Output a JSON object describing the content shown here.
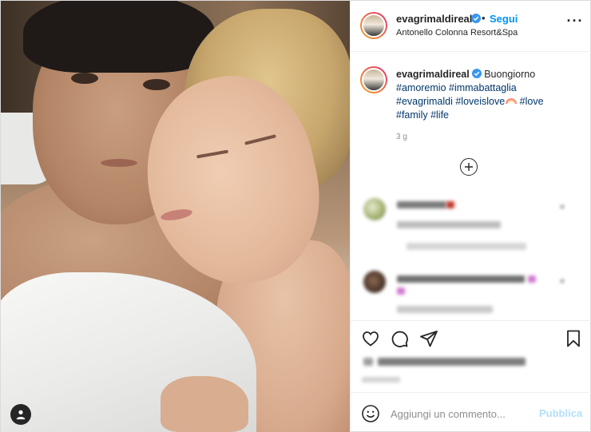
{
  "post": {
    "username": "evagrimaldireal",
    "follow_label": "Segui",
    "separator": "•",
    "location": "Antonello Colonna Resort&Spa",
    "more_label": "···"
  },
  "caption": {
    "username": "evagrimaldireal",
    "text": "Buongiorno",
    "tags_line1": "#amoremio #immabattaglia",
    "tags_line2a": "#evagrimaldi #loveislove",
    "tags_line2b": "#love",
    "tags_line3": "#family #life",
    "time_ago": "3 g"
  },
  "icons": {
    "verified": "verified-badge-icon",
    "tag_user": "user-tag-icon",
    "load_more": "plus-circle-icon",
    "like": "heart-icon",
    "comment": "comment-bubble-icon",
    "share": "paper-plane-icon",
    "save": "bookmark-icon",
    "emoji": "smiley-icon",
    "more": "ellipsis-icon"
  },
  "add_comment": {
    "placeholder": "Aggiungi un commento...",
    "publish_label": "Pubblica"
  },
  "colors": {
    "accent": "#0095f6",
    "publish_disabled": "#b2dffc",
    "hashtag": "#00376b",
    "secondary_text": "#8e8e8e"
  }
}
